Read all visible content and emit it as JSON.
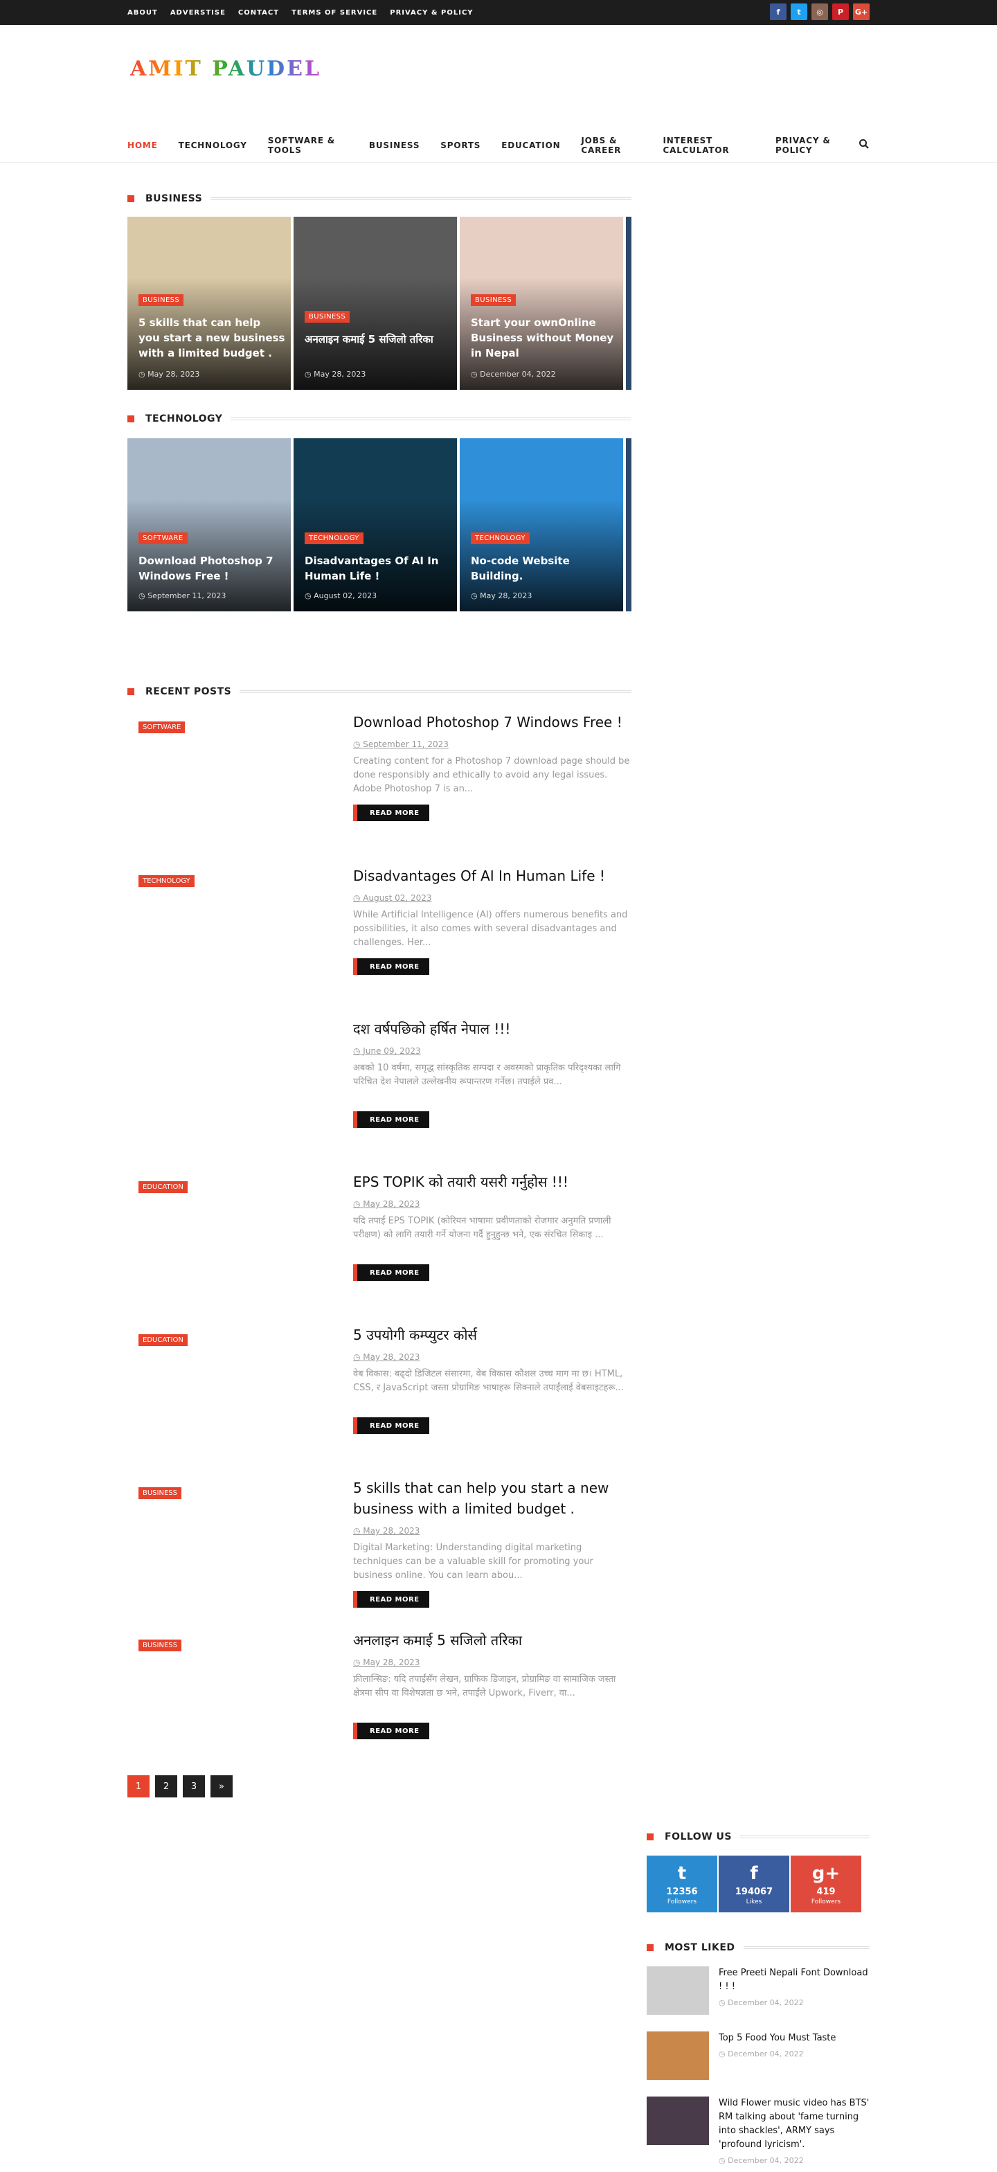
{
  "topbar": {
    "links": [
      "ABOUT",
      "ADVERSTISE",
      "CONTACT",
      "TERMS OF SERVICE",
      "PRIVACY & POLICY"
    ],
    "social": [
      {
        "icon": "facebook-icon",
        "glyph": "f",
        "color": "#3b5998"
      },
      {
        "icon": "twitter-icon",
        "glyph": "t",
        "color": "#1da1f2"
      },
      {
        "icon": "instagram-icon",
        "glyph": "◎",
        "color": "#8a6552"
      },
      {
        "icon": "pinterest-icon",
        "glyph": "P",
        "color": "#cb2027"
      },
      {
        "icon": "google-plus-icon",
        "glyph": "G+",
        "color": "#dd4b39"
      }
    ]
  },
  "logo": "AMIT PAUDEL",
  "nav": {
    "items": [
      "HOME",
      "TECHNOLOGY",
      "SOFTWARE & TOOLS",
      "BUSINESS",
      "SPORTS",
      "EDUCATION",
      "JOBS & CAREER",
      "INTEREST CALCULATOR",
      "PRIVACY & POLICY"
    ],
    "search_icon": "search-icon"
  },
  "business": {
    "heading": "BUSINESS",
    "cards": [
      {
        "label": "BUSINESS",
        "title": "5 skills that can help you start a new business with a limited budget .",
        "date": "May 28, 2023",
        "bg": "#d9c9a6"
      },
      {
        "label": "BUSINESS",
        "title": "अनलाइन कमाई 5 सजिलो तरिका",
        "date": "May 28, 2023",
        "bg": "#5b5b5b"
      },
      {
        "label": "BUSINESS",
        "title": "Start your ownOnline Business without Money in Nepal",
        "date": "December 04, 2022",
        "bg": "#e8cfc4"
      }
    ]
  },
  "technology": {
    "heading": "TECHNOLOGY",
    "cards": [
      {
        "label": "SOFTWARE",
        "title": "Download Photoshop 7 Windows Free !",
        "date": "September 11, 2023",
        "bg": "#a8b8c8"
      },
      {
        "label": "TECHNOLOGY",
        "title": "Disadvantages Of AI In Human Life !",
        "date": "August 02, 2023",
        "bg": "#123c52"
      },
      {
        "label": "TECHNOLOGY",
        "title": "No-code Website Building.",
        "date": "May 28, 2023",
        "bg": "#2f8fd8"
      }
    ]
  },
  "recent": {
    "heading": "RECENT POSTS",
    "read_more": "READ MORE",
    "posts": [
      {
        "label": "SOFTWARE",
        "title": "Download Photoshop 7 Windows Free !",
        "date": "September 11, 2023",
        "snippet": "Creating content for a Photoshop 7 download page should be done responsibly and ethically to avoid any legal issues. Adobe Photoshop 7 is an..."
      },
      {
        "label": "TECHNOLOGY",
        "title": "Disadvantages Of AI In Human Life !",
        "date": "August 02, 2023",
        "snippet": " While Artificial Intelligence (AI) offers numerous benefits and possibilities, it also comes with several disadvantages and challenges. Her..."
      },
      {
        "label": "",
        "title": "दश वर्षपछिको हर्षित नेपाल !!!",
        "date": "June 09, 2023",
        "snippet": " अबको 10 वर्षमा, समृद्ध सांस्कृतिक सम्पदा र अवस्मको प्राकृतिक परिदृश्यका लागि परिचित देश नेपालले उल्लेखनीय रूपान्तरण गर्नेछ। तपाईले प्रव..."
      },
      {
        "label": "EDUCATION",
        "title": "EPS TOPIK को तयारी यसरी गर्नुहोस !!!",
        "date": "May 28, 2023",
        "snippet": "यदि तपाईं EPS TOPIK (कोरियन भाषामा प्रवीणताको रोजगार अनुमति प्रणाली परीक्षण) को लागि तयारी गर्ने योजना गर्दै हुनुहुन्छ भने, एक संरचित सिकाइ ..."
      },
      {
        "label": "EDUCATION",
        "title": "5 उपयोगी कम्प्युटर कोर्स",
        "date": "May 28, 2023",
        "snippet": "वेब विकास: बढ्दो डिजिटल संसारमा, वेब विकास कौशल उच्च माग मा छ। HTML, CSS, र JavaScript जस्ता प्रोग्रामिङ भाषाहरू सिक्नाले तपाईंलाई वेबसाइटहरू..."
      },
      {
        "label": "BUSINESS",
        "title": "5 skills that can help you start a new business with a limited budget .",
        "date": "May 28, 2023",
        "snippet": "Digital Marketing: Understanding digital marketing techniques can be a valuable skill for promoting your business online. You can learn abou..."
      },
      {
        "label": "BUSINESS",
        "title": "अनलाइन कमाई 5 सजिलो तरिका",
        "date": "May 28, 2023",
        "snippet": "फ्रीलान्सिङ: यदि तपाईंसँग लेखन, ग्राफिक डिजाइन, प्रोग्रामिङ वा सामाजिक जस्ता क्षेत्रमा सीप वा विशेषज्ञता छ भने, तपाईंले Upwork, Fiverr, वा..."
      }
    ]
  },
  "pagination": [
    "1",
    "2",
    "3",
    "»"
  ],
  "follow": {
    "heading": "FOLLOW US",
    "items": [
      {
        "icon": "twitter-icon",
        "glyph": "t",
        "count": "12356",
        "label": "Followers",
        "color": "#2b8bd0"
      },
      {
        "icon": "facebook-icon",
        "glyph": "f",
        "count": "194067",
        "label": "Likes",
        "color": "#3a5da0"
      },
      {
        "icon": "google-plus-icon",
        "glyph": "g+",
        "count": "419",
        "label": "Followers",
        "color": "#e04a3c"
      }
    ]
  },
  "most_liked": {
    "heading": "MOST LIKED",
    "items": [
      {
        "title": "Free Preeti Nepali Font Download ! ! !",
        "date": "December 04, 2022",
        "bg": "#cfcfcf"
      },
      {
        "title": "Top 5 Food You Must Taste",
        "date": "December 04, 2022",
        "bg": "#c9874a"
      },
      {
        "title": "Wild Flower music video has BTS' RM talking about 'fame turning into shackles', ARMY says 'profound lyricism'.",
        "date": "December 04, 2022",
        "bg": "#4a3b4a"
      }
    ]
  },
  "date_icon": "clock-icon"
}
